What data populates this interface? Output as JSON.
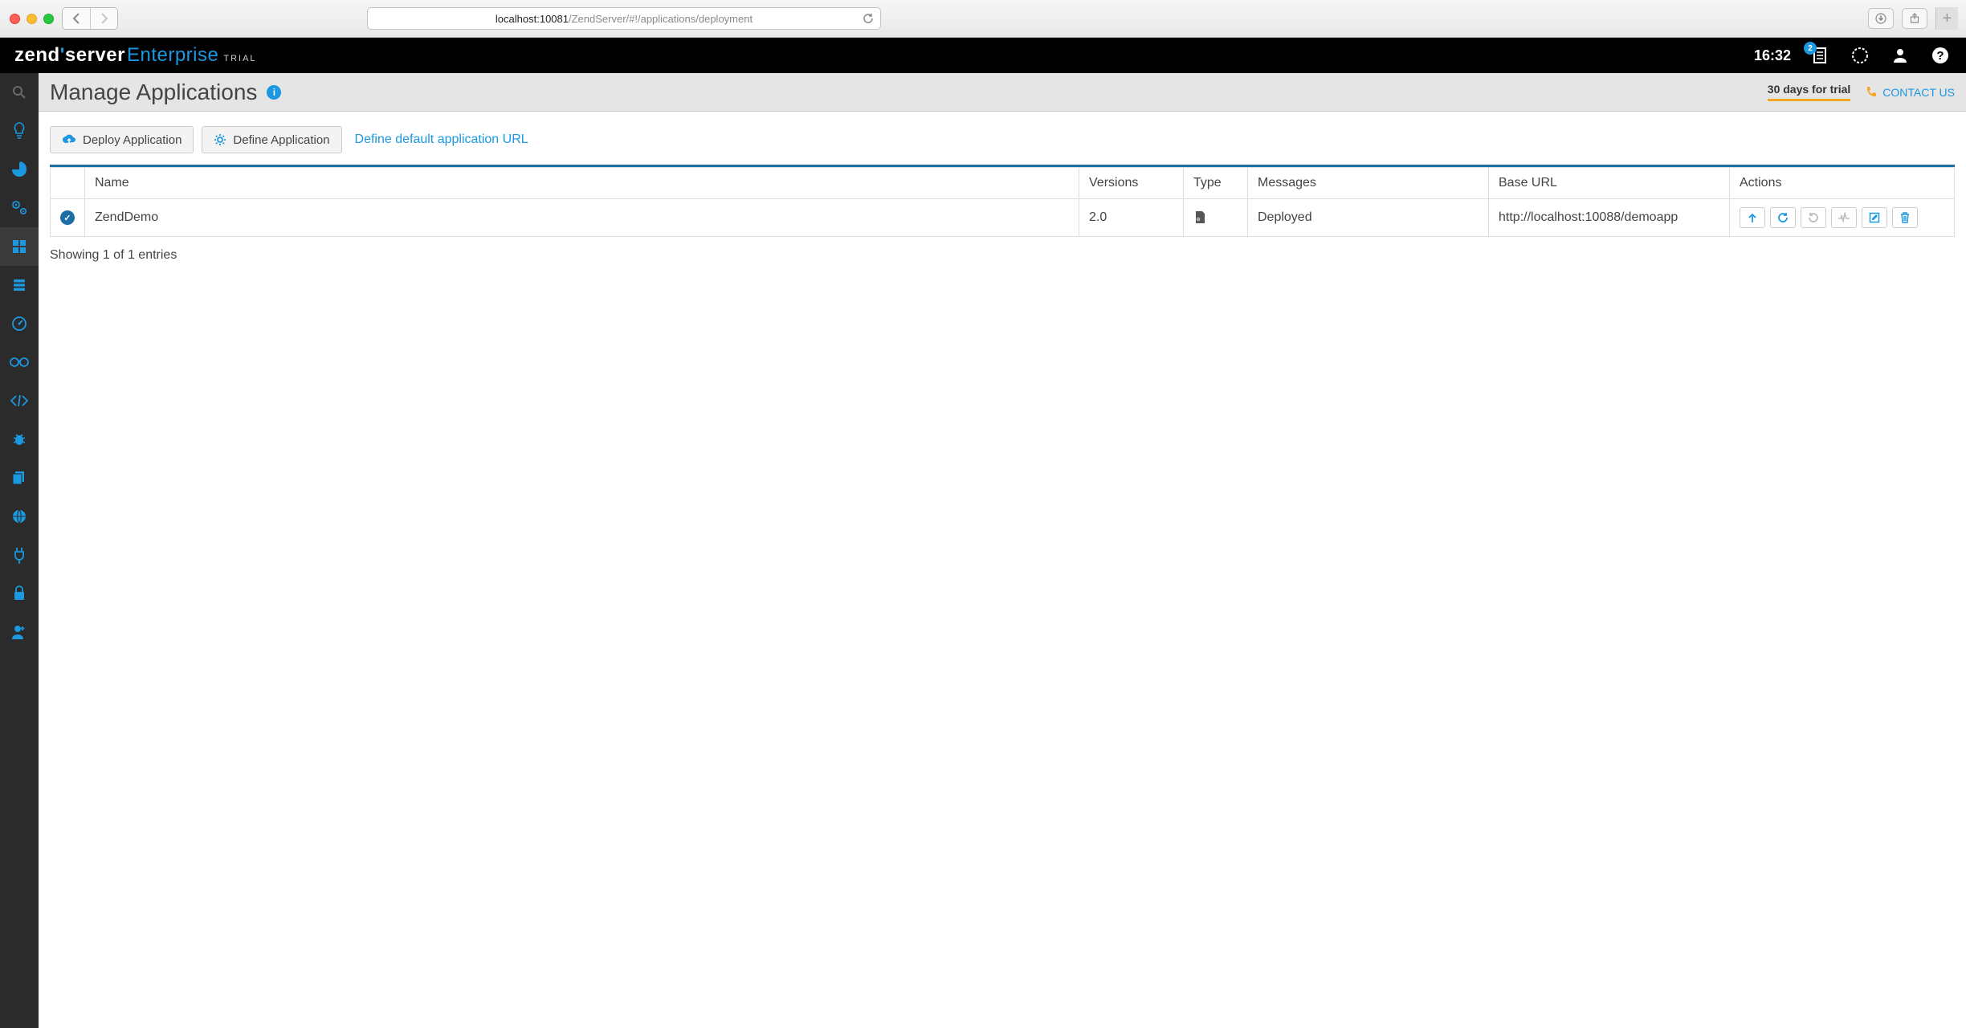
{
  "browser": {
    "url_host": "localhost:10081",
    "url_path": "/ZendServer/#!/applications/deployment"
  },
  "topbar": {
    "brand_primary": "zend",
    "brand_secondary": "server",
    "brand_tertiary": "Enterprise",
    "brand_trial": "TRIAL",
    "time": "16:32",
    "notification_count": "2"
  },
  "header": {
    "title": "Manage Applications",
    "trial_text": "30 days for trial",
    "contact": "CONTACT US"
  },
  "toolbar": {
    "deploy_label": "Deploy Application",
    "define_label": "Define Application",
    "default_url_link": "Define default application URL"
  },
  "table": {
    "columns": {
      "name": "Name",
      "versions": "Versions",
      "type": "Type",
      "messages": "Messages",
      "base_url": "Base URL",
      "actions": "Actions"
    },
    "rows": [
      {
        "name": "ZendDemo",
        "version": "2.0",
        "message": "Deployed",
        "base_url": "http://localhost:10088/demoapp"
      }
    ],
    "entries_text": "Showing 1 of 1 entries"
  }
}
